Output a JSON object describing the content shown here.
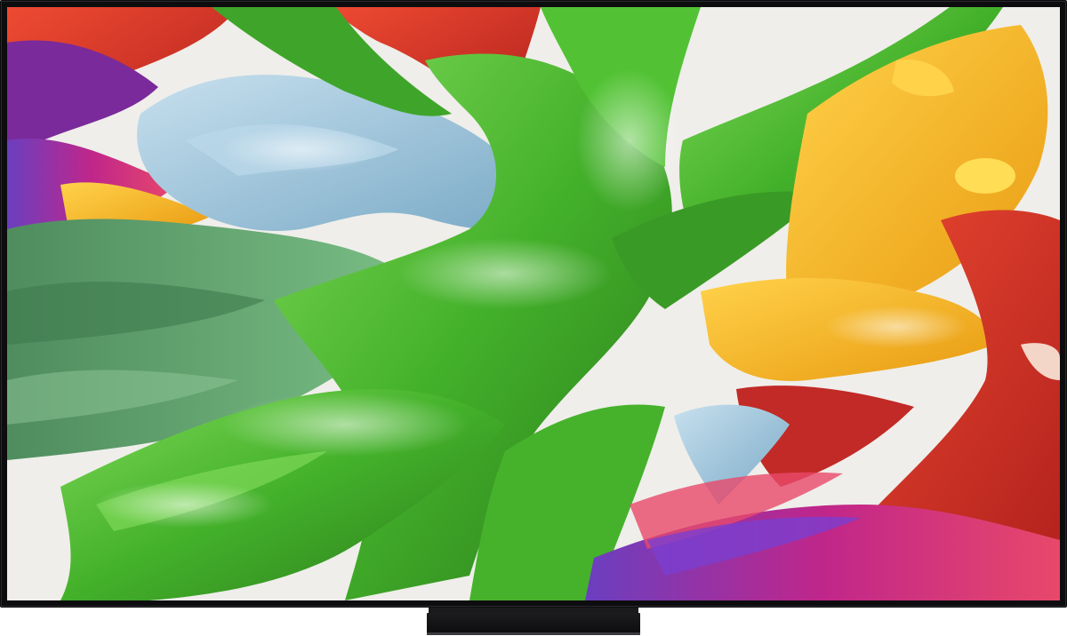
{
  "product": {
    "type": "flat-panel-tv",
    "frame_color": "#0d0d0f",
    "stand_color": "#1a1a1c"
  },
  "screen_content": {
    "subject": "abstract-paint-swirl",
    "palette": {
      "green": "#4fb82e",
      "dark_green": "#2f7a1f",
      "sage": "#6aa57a",
      "light_blue": "#9cc4dc",
      "red": "#d8352a",
      "yellow": "#f2b31c",
      "magenta": "#b0268c",
      "purple": "#6a3fc0",
      "background_white": "#efeeea"
    }
  }
}
